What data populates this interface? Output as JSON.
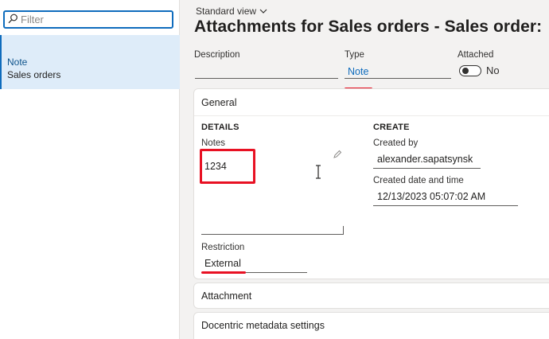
{
  "filter": {
    "placeholder": "Filter"
  },
  "list": {
    "items": [
      {
        "title": "Note",
        "subtitle": "Sales orders"
      }
    ]
  },
  "header": {
    "view_selector": "Standard view",
    "title": "Attachments for Sales orders - Sales order:",
    "description_label": "Description",
    "description_value": "",
    "type_label": "Type",
    "type_value": "Note",
    "attached_label": "Attached",
    "attached_value": "No"
  },
  "general": {
    "title": "General",
    "details": {
      "heading": "DETAILS",
      "notes_label": "Notes",
      "notes_value": "1234",
      "restriction_label": "Restriction",
      "restriction_value": "External"
    },
    "create": {
      "heading": "CREATE",
      "created_by_label": "Created by",
      "created_by_value": "alexander.sapatsynsk",
      "created_date_label": "Created date and time",
      "created_date_value": "12/13/2023 05:07:02 AM"
    }
  },
  "sections": {
    "attachment": "Attachment",
    "docentric": "Docentric metadata settings"
  },
  "colors": {
    "accent": "#0f6cbd",
    "highlight": "#e81123",
    "selected_bg": "#deecf9"
  },
  "icons": [
    "search-icon",
    "chevron-down-icon",
    "pencil-icon",
    "text-cursor-icon"
  ]
}
